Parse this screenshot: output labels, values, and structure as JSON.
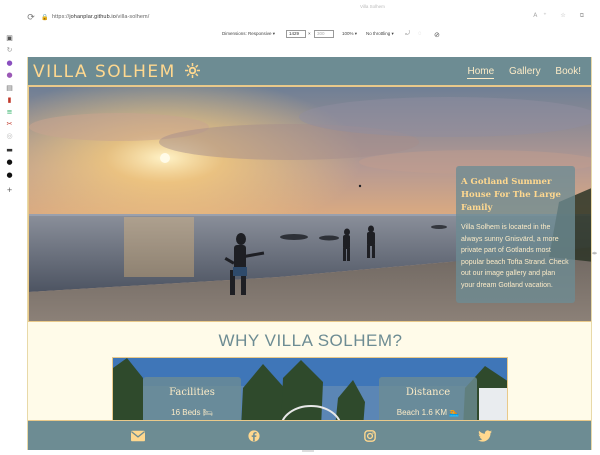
{
  "browser": {
    "url_scheme": "https://",
    "url_host": "johanplar.github.io",
    "url_path": "/villa-solhem/",
    "tab_title": "Villa Solhem"
  },
  "devtools": {
    "dimensions_label": "Dimensions: Responsive",
    "width": "1429",
    "height": "300",
    "times": "×",
    "zoom": "100%",
    "throttling": "No throttling"
  },
  "sidebar_icons": [
    "tab-icon",
    "history-icon",
    "extension-icon",
    "extension-icon",
    "document-icon",
    "bookmark-icon",
    "list-icon",
    "tool-icon",
    "settings-icon",
    "wallet-icon",
    "github-icon",
    "github-icon",
    "add-icon"
  ],
  "site": {
    "logo": "VILLA SOLHEM",
    "logo_icon": "sun-icon",
    "nav": [
      {
        "label": "Home",
        "active": true
      },
      {
        "label": "Gallery",
        "active": false
      },
      {
        "label": "Book!",
        "active": false
      }
    ],
    "hero_title": "A Gotland Summer House For The Large Family",
    "hero_text": "Villa Solhem is located in the always sunny Gnisvärd, a more private part of Gotlands most popular beach Tofta Strand. Check out our image gallery and plan your dream Gotland vacation.",
    "why_heading": "WHY VILLA SOLHEM?",
    "features": [
      {
        "title": "Facilities",
        "text": "16 Beds",
        "icon": "bed-icon"
      },
      {
        "title": "Distance",
        "text": "Beach 1.6 KM",
        "icon": "swimmer-icon"
      }
    ],
    "footer_icons": [
      "envelope-icon",
      "facebook-icon",
      "instagram-icon",
      "twitter-icon"
    ]
  },
  "colors": {
    "nav_bg": "#6d8c93",
    "accent": "#ffd88f",
    "page_bg": "#fffbe9",
    "border": "#e9c98a"
  }
}
